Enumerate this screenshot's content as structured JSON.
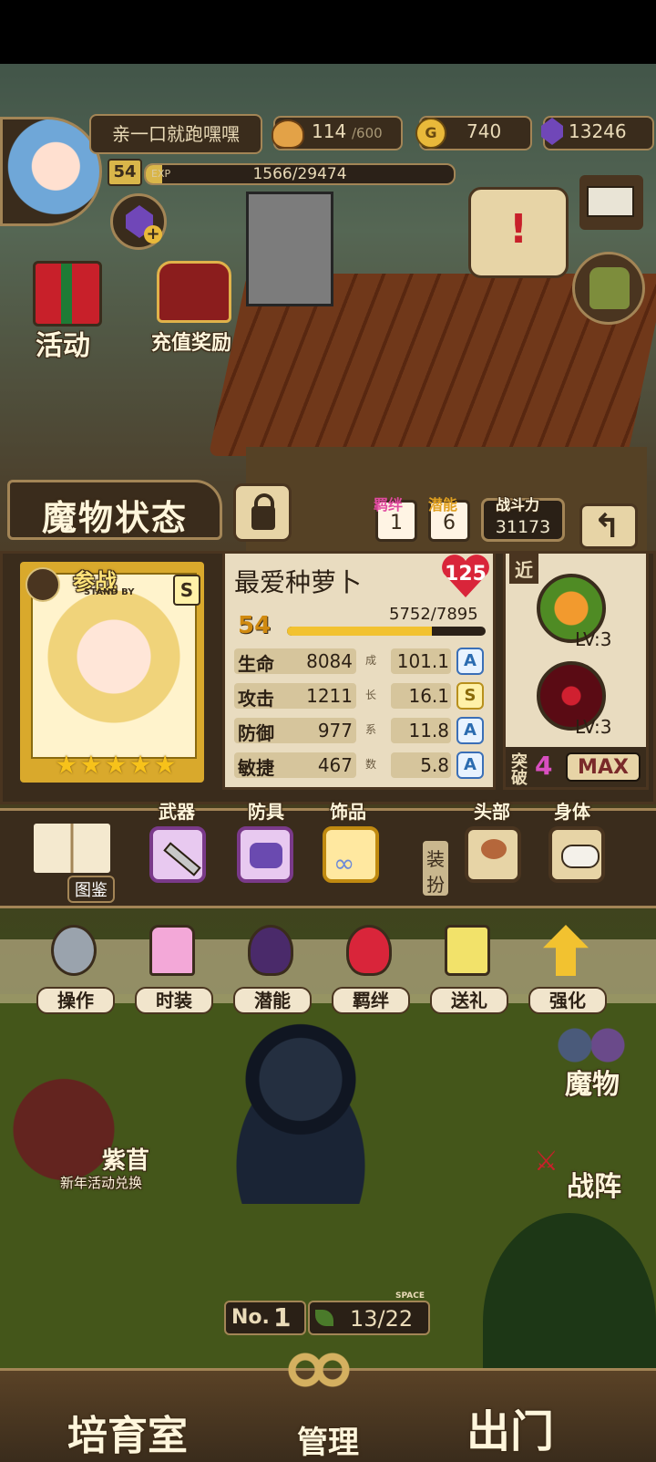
{
  "player": {
    "name": "亲一口就跑嘿嘿",
    "level": "54",
    "exp_label": "EXP",
    "exp_text": "1566/29474",
    "exp_fraction": 0.053
  },
  "resources": {
    "bread_value": "114",
    "bread_max": "/600",
    "gold_value": "740",
    "gem_value": "13246"
  },
  "top_buttons": {
    "event_label": "活动",
    "recharge_label": "充值奖励"
  },
  "panel": {
    "title": "魔物状态",
    "bond_label": "羁绊",
    "bond_value": "1",
    "potential_label": "潜能",
    "potential_value": "6",
    "power_label": "战斗力",
    "power_value": "31173"
  },
  "monster": {
    "stand_by_cn": "参战",
    "stand_by_en": "STAND BY",
    "rank": "S",
    "name": "最爱种萝卜",
    "heart_value": "125",
    "level": "54",
    "exp_text": "5752/7895",
    "exp_fraction": 0.729,
    "stars": 5
  },
  "stats": [
    {
      "name": "生命",
      "value": "8084",
      "growth": "101.1",
      "grade": "A"
    },
    {
      "name": "攻击",
      "value": "1211",
      "growth": "16.1",
      "grade": "S"
    },
    {
      "name": "防御",
      "value": "977",
      "growth": "11.8",
      "grade": "A"
    },
    {
      "name": "敏捷",
      "value": "467",
      "growth": "5.8",
      "grade": "A"
    }
  ],
  "growth_label": [
    "成",
    "长",
    "系",
    "数"
  ],
  "skills": {
    "range_label": "近",
    "skill1_level": "LV:3",
    "skill2_level": "LV:3",
    "breakthrough_label_1": "突",
    "breakthrough_label_2": "破",
    "breakthrough_value": "4",
    "max_label": "MAX"
  },
  "equipment": {
    "book_label": "图鉴",
    "weapon_label": "武器",
    "armor_label": "防具",
    "accessory_label": "饰品",
    "dress_label_1": "装",
    "dress_label_2": "扮",
    "head_label": "头部",
    "body_label": "身体"
  },
  "menu": [
    "操作",
    "时装",
    "潜能",
    "羁绊",
    "送礼",
    "强化"
  ],
  "side_buttons": {
    "monster_label": "魔物",
    "formation_label": "战阵",
    "event_char_name": "紫苜",
    "event_char_sub": "新年活动兑换"
  },
  "bottom": {
    "no_label": "No.",
    "no_value": "1",
    "space_label": "SPACE",
    "space_value": "13/22",
    "nav_left": "培育室",
    "nav_center": "管理",
    "nav_right": "出门"
  },
  "colors": {
    "gold": "#f2c230",
    "purple_gem": "#6b3fb0",
    "grade_a": "#2b6cb0",
    "grade_s": "#b8901c",
    "heart_red": "#d9253a",
    "max_text": "#7a2a2a",
    "break_pink": "#d94fc0"
  }
}
